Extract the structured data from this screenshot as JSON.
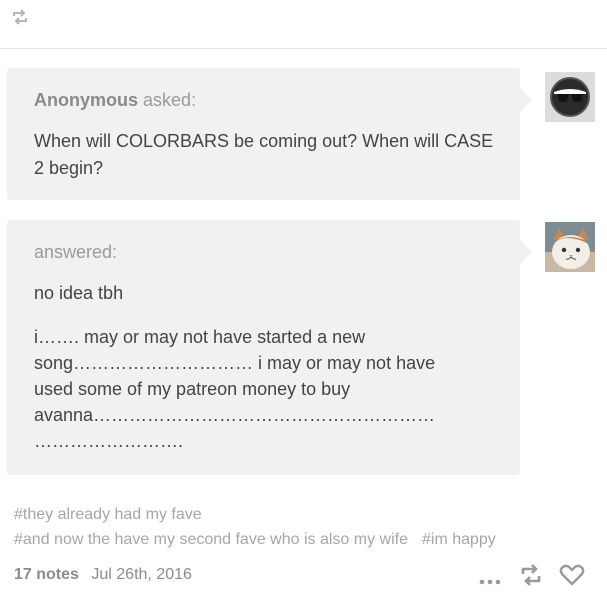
{
  "icons": {
    "top_reblog": "reblog-icon",
    "more": "more-dots-icon",
    "reblog": "reblog-icon",
    "like": "heart-icon"
  },
  "question": {
    "asker_name": "Anonymous",
    "asker_suffix": "asked:",
    "text": "When will COLORBARS be coming out? When will CASE 2 begin?"
  },
  "answer": {
    "label": "answered:",
    "line1": "no idea tbh",
    "text": "i……. may or may not have started a new\nsong………………………… i may or may not have\n used some of my patreon money to buy\navanna…………………………………………………\n……………………."
  },
  "tags": {
    "line1": [
      "#they already had my fave"
    ],
    "line2": [
      "#and now the have my second fave who is also my wife",
      "#im happy"
    ]
  },
  "footer": {
    "notes": "17 notes",
    "date": "Jul 26th, 2016"
  },
  "colors": {
    "bubble": "#f1f1f1",
    "muted_text": "#a6a6a6",
    "body_text": "#444444"
  }
}
